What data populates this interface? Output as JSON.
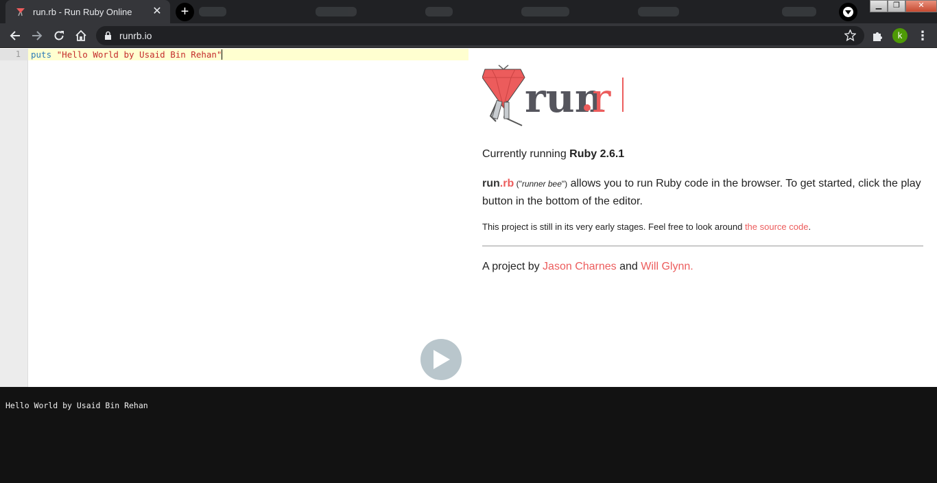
{
  "browser": {
    "tab": {
      "title": "run.rb - Run Ruby Online",
      "close": "✕"
    },
    "new_tab": "+",
    "url": "runrb.io",
    "avatar_letter": "k",
    "menu": "⋮"
  },
  "window_controls": {
    "minimize": "▁",
    "restore": "❐",
    "close": "✕"
  },
  "editor": {
    "line_numbers": [
      "1"
    ],
    "code": {
      "keyword": "puts",
      "string": "\"Hello World by Usaid Bin Rehan\""
    }
  },
  "info": {
    "logo": {
      "prefix": "run",
      "suffix": "rb"
    },
    "running": {
      "label": "Currently running ",
      "version": "Ruby 2.6.1"
    },
    "about": {
      "brand_run": "run",
      "brand_dot": ".rb",
      "paren_open": " (\"",
      "nickname": "runner bee",
      "paren_close": "\")",
      "text": " allows you to run Ruby code in the browser. To get started, click the play button in the bottom of the editor."
    },
    "stage": {
      "text": "This project is still in its very early stages. Feel free to look around ",
      "link": "the source code",
      "end": "."
    },
    "credit": {
      "prefix": "A project by ",
      "author1": "Jason Charnes",
      "and": " and ",
      "author2": "Will Glynn."
    }
  },
  "output": {
    "text": "Hello World by Usaid Bin Rehan"
  },
  "colors": {
    "accent": "#ec5c5c",
    "editor_active_line": "#ffffd0",
    "output_bg": "#121212"
  }
}
